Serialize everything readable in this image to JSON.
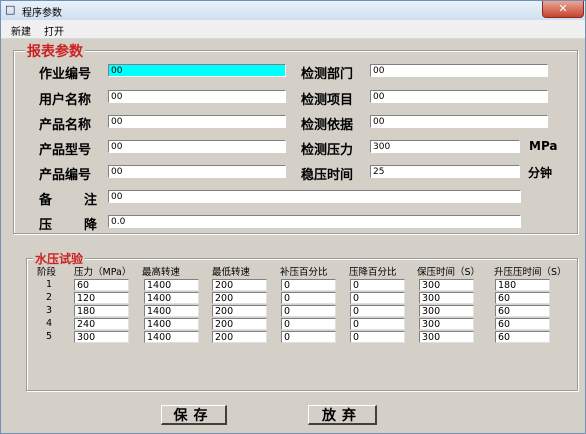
{
  "window": {
    "title": "程序参数",
    "close_glyph": "✕"
  },
  "menu": [
    "新建",
    "打开"
  ],
  "report": {
    "section_title": "报表参数",
    "left": [
      {
        "label": "作业编号",
        "value": "00"
      },
      {
        "label": "用户名称",
        "value": "00"
      },
      {
        "label": "产品名称",
        "value": "00"
      },
      {
        "label": "产品型号",
        "value": "00"
      },
      {
        "label": "产品编号",
        "value": "00"
      }
    ],
    "right": [
      {
        "label": "检测部门",
        "value": "00",
        "unit": ""
      },
      {
        "label": "检测项目",
        "value": "00",
        "unit": ""
      },
      {
        "label": "检测依据",
        "value": "00",
        "unit": ""
      },
      {
        "label": "检测压力",
        "value": "300",
        "unit": "MPa"
      },
      {
        "label": "稳压时间",
        "value": "25",
        "unit": "分钟"
      }
    ],
    "remark": {
      "label_a": "备",
      "label_b": "注",
      "value": "00"
    },
    "pressure_drop": {
      "label_a": "压",
      "label_b": "降",
      "value": "0.0"
    }
  },
  "hydro": {
    "section_title": "水压试验",
    "columns": [
      "阶段",
      "压力（MPa）",
      "最高转速",
      "最低转速",
      "补压百分比",
      "压降百分比",
      "保压时间（S）",
      "升压压时间（S）"
    ],
    "rows": [
      {
        "stage": "1",
        "vals": [
          "60",
          "1400",
          "200",
          "0",
          "0",
          "300",
          "180"
        ]
      },
      {
        "stage": "2",
        "vals": [
          "120",
          "1400",
          "200",
          "0",
          "0",
          "300",
          "60"
        ]
      },
      {
        "stage": "3",
        "vals": [
          "180",
          "1400",
          "200",
          "0",
          "0",
          "300",
          "60"
        ]
      },
      {
        "stage": "4",
        "vals": [
          "240",
          "1400",
          "200",
          "0",
          "0",
          "300",
          "60"
        ]
      },
      {
        "stage": "5",
        "vals": [
          "300",
          "1400",
          "200",
          "0",
          "0",
          "300",
          "60"
        ]
      }
    ]
  },
  "buttons": {
    "save": "保存",
    "discard": "放弃"
  }
}
